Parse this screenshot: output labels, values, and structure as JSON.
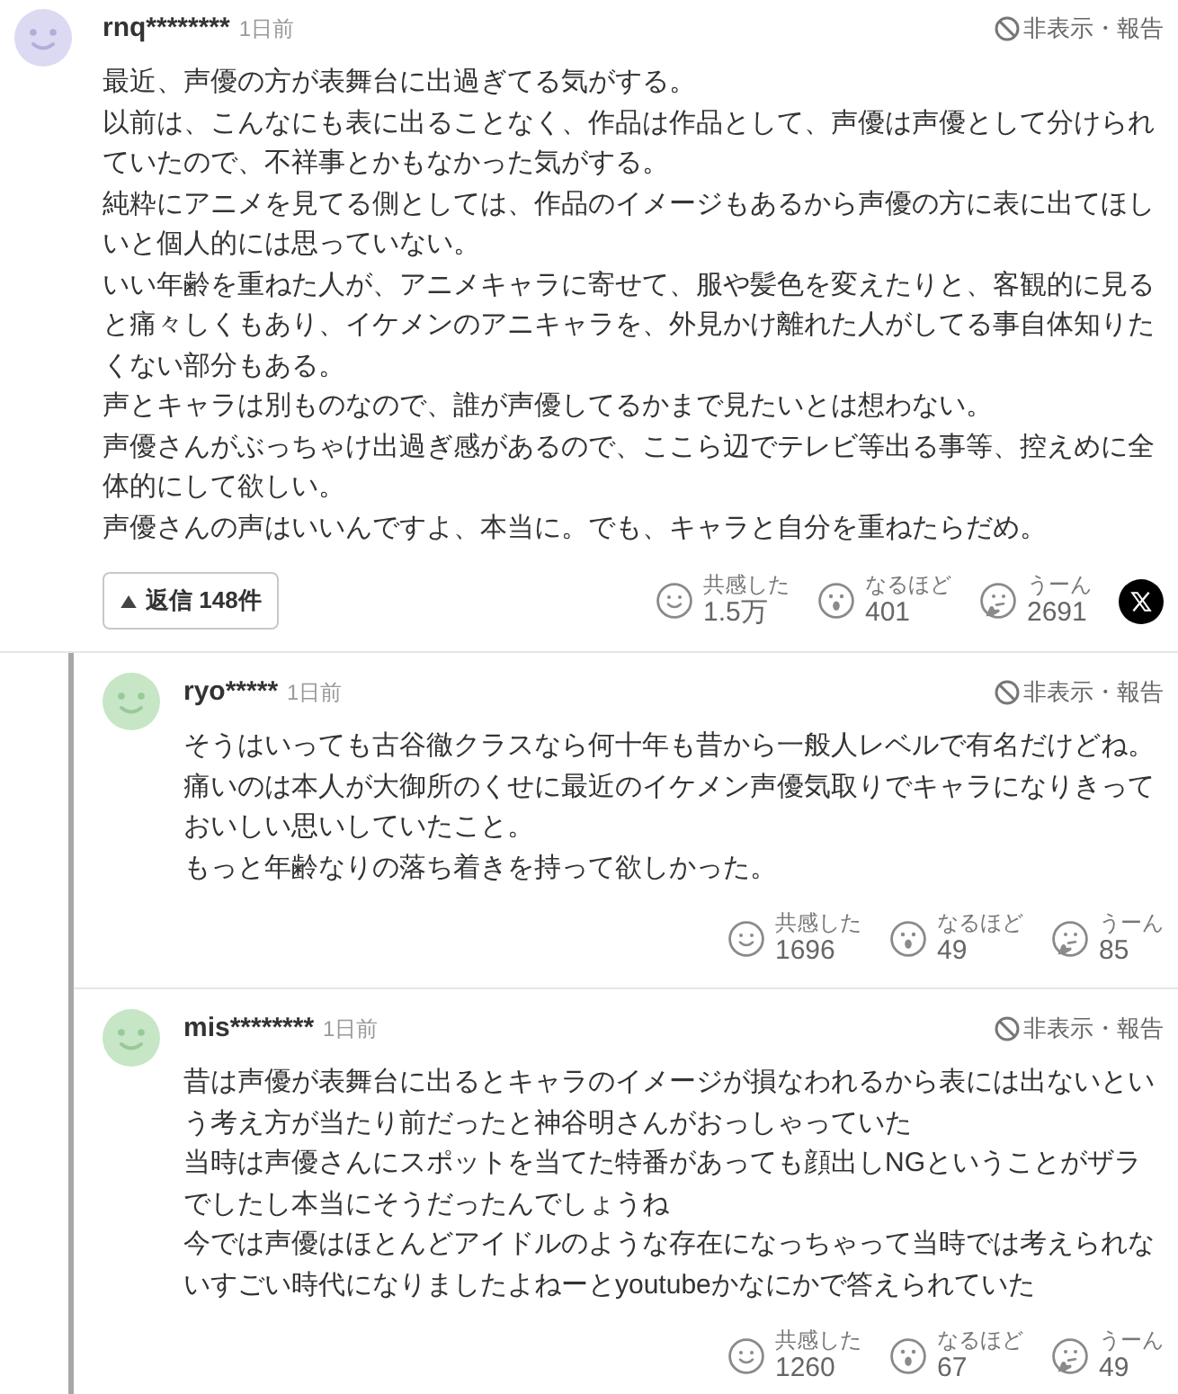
{
  "comment": {
    "user": "rnq********",
    "time": "1日前",
    "action": "非表示・報告",
    "body": [
      "最近、声優の方が表舞台に出過ぎてる気がする。",
      "以前は、こんなにも表に出ることなく、作品は作品として、声優は声優として分けられていたので、不祥事とかもなかった気がする。",
      "純粋にアニメを見てる側としては、作品のイメージもあるから声優の方に表に出てほしいと個人的には思っていない。",
      "いい年齢を重ねた人が、アニメキャラに寄せて、服や髪色を変えたりと、客観的に見ると痛々しくもあり、イケメンのアニキャラを、外見かけ離れた人がしてる事自体知りたくない部分もある。",
      "声とキャラは別ものなので、誰が声優してるかまで見たいとは想わない。",
      "声優さんがぶっちゃけ出過ぎ感があるので、ここら辺でテレビ等出る事等、控えめに全体的にして欲しい。",
      "声優さんの声はいいんですよ、本当に。でも、キャラと自分を重ねたらだめ。"
    ],
    "replies_button": {
      "label": "返信 148件",
      "expanded": true
    },
    "reactions": [
      {
        "kind": "empathy",
        "label": "共感した",
        "count": "1.5万"
      },
      {
        "kind": "insight",
        "label": "なるほど",
        "count": "401"
      },
      {
        "kind": "hmm",
        "label": "うーん",
        "count": "2691"
      }
    ]
  },
  "replies": [
    {
      "user": "ryo*****",
      "time": "1日前",
      "action": "非表示・報告",
      "body": [
        "そうはいっても古谷徹クラスなら何十年も昔から一般人レベルで有名だけどね。",
        "痛いのは本人が大御所のくせに最近のイケメン声優気取りでキャラになりきっておいしい思いしていたこと。",
        "もっと年齢なりの落ち着きを持って欲しかった。"
      ],
      "reactions": [
        {
          "kind": "empathy",
          "label": "共感した",
          "count": "1696"
        },
        {
          "kind": "insight",
          "label": "なるほど",
          "count": "49"
        },
        {
          "kind": "hmm",
          "label": "うーん",
          "count": "85"
        }
      ]
    },
    {
      "user": "mis********",
      "time": "1日前",
      "action": "非表示・報告",
      "body": [
        "昔は声優が表舞台に出るとキャラのイメージが損なわれるから表には出ないという考え方が当たり前だったと神谷明さんがおっしゃっていた",
        "当時は声優さんにスポットを当てた特番があっても顔出しNGということがザラでしたし本当にそうだったんでしょうね",
        "今では声優はほとんどアイドルのような存在になっちゃって当時では考えられないすごい時代になりましたよねーとyoutubeかなにかで答えられていた"
      ],
      "reactions": [
        {
          "kind": "empathy",
          "label": "共感した",
          "count": "1260"
        },
        {
          "kind": "insight",
          "label": "なるほど",
          "count": "67"
        },
        {
          "kind": "hmm",
          "label": "うーん",
          "count": "49"
        }
      ]
    }
  ]
}
